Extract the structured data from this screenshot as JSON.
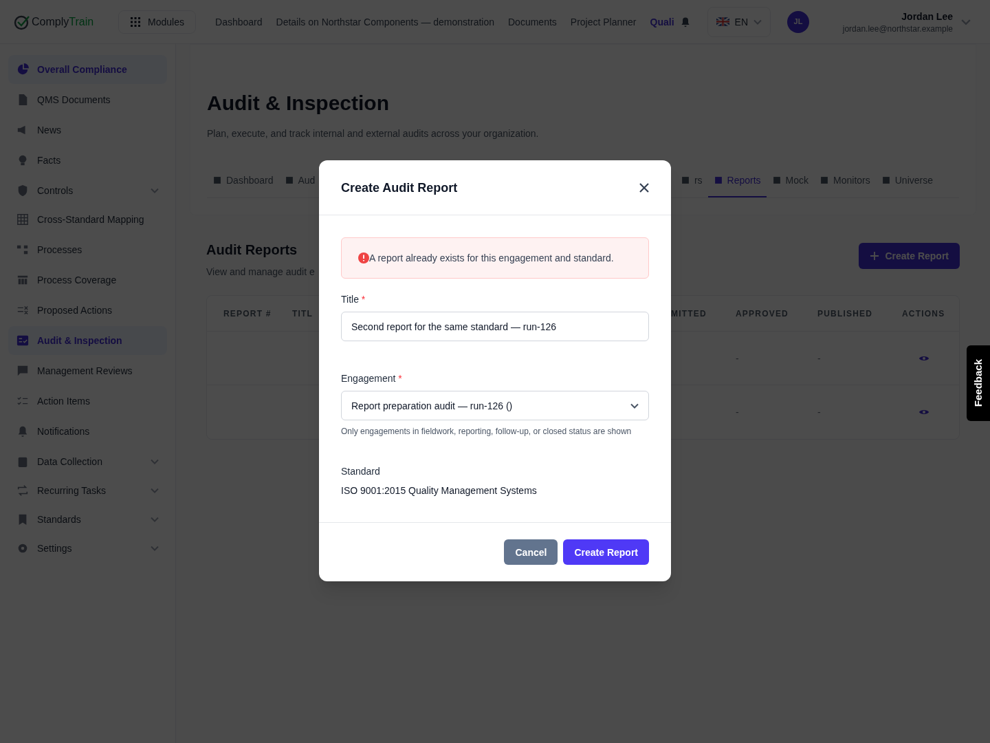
{
  "brand": {
    "first": "Comply",
    "second": "Train"
  },
  "modules_button": "Modules",
  "nav": [
    {
      "label": "Dashboard",
      "selected": false
    },
    {
      "label": "Details on Northstar Components — demonstration",
      "selected": false
    },
    {
      "label": "Documents",
      "selected": false
    },
    {
      "label": "Project Planner",
      "selected": false
    },
    {
      "label": "Quali",
      "selected": true
    }
  ],
  "language": "EN",
  "user": {
    "initials": "JL",
    "name": "Jordan Lee",
    "email": "jordan.lee@northstar.example"
  },
  "sidebar": [
    {
      "label": "Overall Compliance",
      "selected": true,
      "kind": "link"
    },
    {
      "label": "QMS Documents",
      "selected": false,
      "kind": "link"
    },
    {
      "label": "News",
      "selected": false,
      "kind": "link"
    },
    {
      "label": "Facts",
      "selected": false,
      "kind": "link"
    },
    {
      "label": "Controls",
      "selected": false,
      "kind": "group"
    },
    {
      "label": "Cross-Standard Mapping",
      "selected": false,
      "kind": "link"
    },
    {
      "label": "Processes",
      "selected": false,
      "kind": "link"
    },
    {
      "label": "Process Coverage",
      "selected": false,
      "kind": "link"
    },
    {
      "label": "Proposed Actions",
      "selected": false,
      "kind": "link"
    },
    {
      "label": "Audit & Inspection",
      "selected": true,
      "kind": "link"
    },
    {
      "label": "Management Reviews",
      "selected": false,
      "kind": "link"
    },
    {
      "label": "Action Items",
      "selected": false,
      "kind": "link"
    },
    {
      "label": "Notifications",
      "selected": false,
      "kind": "link"
    },
    {
      "label": "Data Collection",
      "selected": false,
      "kind": "group"
    },
    {
      "label": "Recurring Tasks",
      "selected": false,
      "kind": "group"
    },
    {
      "label": "Standards",
      "selected": false,
      "kind": "group"
    },
    {
      "label": "Settings",
      "selected": false,
      "kind": "group"
    }
  ],
  "page": {
    "title": "Audit & Inspection",
    "subtitle": "Plan, execute, and track internal and external audits across your organization."
  },
  "tabs_left": [
    {
      "label": "Dashboard",
      "selected": false
    },
    {
      "label": "Aud",
      "selected": false
    }
  ],
  "tabs_right": [
    {
      "label": "rs",
      "selected": false
    },
    {
      "label": "Reports",
      "selected": true
    },
    {
      "label": "Mock",
      "selected": false
    },
    {
      "label": "Monitors",
      "selected": false
    },
    {
      "label": "Universe",
      "selected": false
    }
  ],
  "section": {
    "title": "Audit Reports",
    "subtitle": "View and manage audit e",
    "create_button": "Create Report"
  },
  "table": {
    "columns_left": [
      "REPORT #",
      "TITL"
    ],
    "columns_right": [
      "MITTED",
      "APPROVED",
      "PUBLISHED",
      "ACTIONS"
    ],
    "rows": [
      {
        "approved": "-",
        "published": "-"
      },
      {
        "approved": "-",
        "published": "-"
      }
    ]
  },
  "modal": {
    "title": "Create Audit Report",
    "error": "A report already exists for this engagement and standard.",
    "title_label": "Title",
    "title_required_mark": "*",
    "title_value": "Second report for the same standard — run-126",
    "engagement_label": "Engagement",
    "engagement_required_mark": "*",
    "engagement_value": "Report preparation audit — run-126 ()",
    "engagement_help": "Only engagements in fieldwork, reporting, follow-up, or closed status are shown",
    "standard_label": "Standard",
    "standard_value": "ISO 9001:2015 Quality Management Systems",
    "cancel": "Cancel",
    "submit": "Create Report"
  },
  "feedback": "Feedback"
}
